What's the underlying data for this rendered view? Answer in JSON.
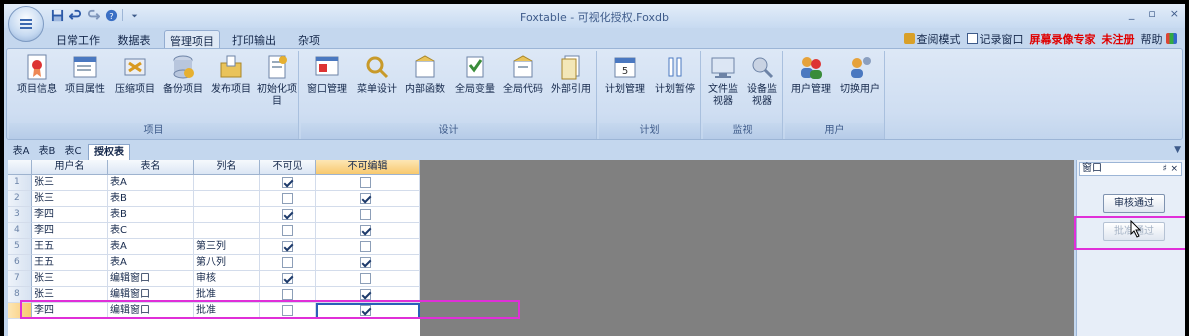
{
  "window": {
    "title": "Foxtable - 可视化授权.Foxdb",
    "minimize": "_",
    "restore": "▫",
    "close": "×"
  },
  "menu_tabs": [
    {
      "label": "日常工作"
    },
    {
      "label": "数据表"
    },
    {
      "label": "管理项目"
    },
    {
      "label": "打印输出"
    },
    {
      "label": "杂项"
    }
  ],
  "right_tools": {
    "query_mode": "查阅模式",
    "record_window": "记录窗口",
    "watermark": "屏幕录像专家",
    "watermark2": "未注册",
    "help": "帮助"
  },
  "ribbon": {
    "groups": [
      {
        "label": "项目",
        "buttons": [
          {
            "label": "项目信息",
            "icon": "project-info-icon"
          },
          {
            "label": "项目属性",
            "icon": "project-properties-icon"
          },
          {
            "label": "压缩项目",
            "icon": "compress-project-icon"
          },
          {
            "label": "备份项目",
            "icon": "backup-project-icon"
          },
          {
            "label": "发布项目",
            "icon": "publish-project-icon"
          },
          {
            "label": "初始化项目",
            "icon": "initialize-project-icon"
          }
        ]
      },
      {
        "label": "设计",
        "buttons": [
          {
            "label": "窗口管理",
            "icon": "window-manager-icon"
          },
          {
            "label": "菜单设计",
            "icon": "menu-design-icon"
          },
          {
            "label": "内部函数",
            "icon": "internal-function-icon"
          },
          {
            "label": "全局变量",
            "icon": "global-variable-icon"
          },
          {
            "label": "全局代码",
            "icon": "global-code-icon"
          },
          {
            "label": "外部引用",
            "icon": "external-reference-icon"
          }
        ]
      },
      {
        "label": "计划",
        "buttons": [
          {
            "label": "计划管理",
            "icon": "plan-manager-icon"
          },
          {
            "label": "计划暂停",
            "icon": "plan-pause-icon"
          }
        ]
      },
      {
        "label": "监视",
        "buttons": [
          {
            "label": "文件监视器",
            "icon": "file-monitor-icon"
          },
          {
            "label": "设备监视器",
            "icon": "device-monitor-icon"
          }
        ]
      },
      {
        "label": "用户",
        "buttons": [
          {
            "label": "用户管理",
            "icon": "user-manager-icon"
          },
          {
            "label": "切换用户",
            "icon": "switch-user-icon"
          }
        ]
      }
    ]
  },
  "sheet_tabs": [
    {
      "label": "表A"
    },
    {
      "label": "表B"
    },
    {
      "label": "表C"
    },
    {
      "label": "授权表"
    }
  ],
  "table": {
    "columns": [
      "用户名",
      "表名",
      "列名",
      "不可见",
      "不可编辑"
    ],
    "rows": [
      {
        "n": "1",
        "user": "张三",
        "table": "表A",
        "col": "",
        "invisible": true,
        "readonly": false
      },
      {
        "n": "2",
        "user": "张三",
        "table": "表B",
        "col": "",
        "invisible": false,
        "readonly": true
      },
      {
        "n": "3",
        "user": "李四",
        "table": "表B",
        "col": "",
        "invisible": true,
        "readonly": false
      },
      {
        "n": "4",
        "user": "李四",
        "table": "表C",
        "col": "",
        "invisible": false,
        "readonly": true
      },
      {
        "n": "5",
        "user": "王五",
        "table": "表A",
        "col": "第三列",
        "invisible": true,
        "readonly": false
      },
      {
        "n": "6",
        "user": "王五",
        "table": "表A",
        "col": "第八列",
        "invisible": false,
        "readonly": true
      },
      {
        "n": "7",
        "user": "张三",
        "table": "编辑窗口",
        "col": "审核",
        "invisible": true,
        "readonly": false
      },
      {
        "n": "8",
        "user": "张三",
        "table": "编辑窗口",
        "col": "批准",
        "invisible": false,
        "readonly": true
      },
      {
        "n": "",
        "user": "李四",
        "table": "编辑窗口",
        "col": "批准",
        "invisible": false,
        "readonly": true
      }
    ]
  },
  "pane": {
    "title": "窗口",
    "pin": "♯",
    "close": "×",
    "approve_review": "审核通过",
    "approve_final": "批准通过"
  }
}
